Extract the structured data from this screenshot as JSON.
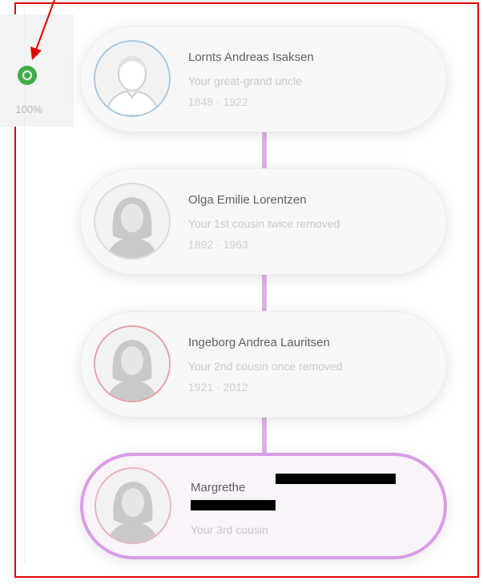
{
  "match": {
    "percent": "100%",
    "accent_color": "#3fae49"
  },
  "annotation": {
    "color": "#e00000"
  },
  "path": {
    "connector_color": "#dfb2e6",
    "current_border_color": "#d99ce5",
    "people": [
      {
        "name": "Lornts Andreas Isaksen",
        "relation": "Your great-grand uncle",
        "years": "1848 · 1922",
        "gender": "male",
        "ring_color": "#a9c7e0"
      },
      {
        "name": "Olga Emilie Lorentzen",
        "relation": "Your 1st cousin twice removed",
        "years": "1892 · 1963",
        "gender": "female",
        "ring_color": "#dcdcdc"
      },
      {
        "name": "Ingeborg Andrea Lauritsen",
        "relation": "Your 2nd cousin once removed",
        "years": "1921 · 2012",
        "gender": "female",
        "ring_color": "#e7a0a8"
      },
      {
        "name": "Margrethe",
        "relation": "Your 3rd cousin",
        "years": "",
        "gender": "female",
        "ring_color": "#e6b4bc"
      }
    ]
  }
}
